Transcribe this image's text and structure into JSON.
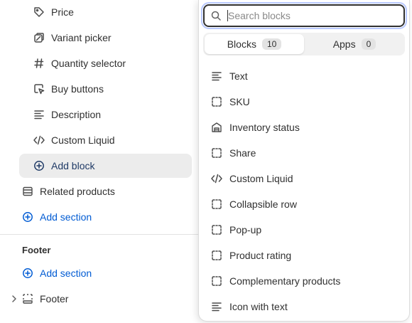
{
  "sidebar": {
    "blocks": [
      {
        "label": "Price",
        "icon": "price-tag-icon"
      },
      {
        "label": "Variant picker",
        "icon": "variant-icon"
      },
      {
        "label": "Quantity selector",
        "icon": "hash-icon"
      },
      {
        "label": "Buy buttons",
        "icon": "cursor-click-icon"
      },
      {
        "label": "Description",
        "icon": "text-lines-icon"
      },
      {
        "label": "Custom Liquid",
        "icon": "code-icon"
      }
    ],
    "add_block_label": "Add block",
    "related_products_label": "Related products",
    "add_section_label": "Add section",
    "footer_group_title": "Footer",
    "footer_add_section_label": "Add section",
    "footer_section_label": "Footer"
  },
  "popover": {
    "search_placeholder": "Search blocks",
    "search_value": "",
    "tabs": [
      {
        "label": "Blocks",
        "count": "10",
        "active": true
      },
      {
        "label": "Apps",
        "count": "0",
        "active": false
      }
    ],
    "items": [
      {
        "label": "Text",
        "icon": "text-lines-icon"
      },
      {
        "label": "SKU",
        "icon": "dashed-square-icon"
      },
      {
        "label": "Inventory status",
        "icon": "warehouse-icon"
      },
      {
        "label": "Share",
        "icon": "dashed-square-icon"
      },
      {
        "label": "Custom Liquid",
        "icon": "code-icon"
      },
      {
        "label": "Collapsible row",
        "icon": "dashed-square-icon"
      },
      {
        "label": "Pop-up",
        "icon": "dashed-square-icon"
      },
      {
        "label": "Product rating",
        "icon": "dashed-square-icon"
      },
      {
        "label": "Complementary products",
        "icon": "dashed-square-icon"
      },
      {
        "label": "Icon with text",
        "icon": "text-lines-icon"
      }
    ]
  },
  "colors": {
    "accent_blue": "#005bd3",
    "text": "#303030",
    "selected_bg": "#ececec"
  }
}
